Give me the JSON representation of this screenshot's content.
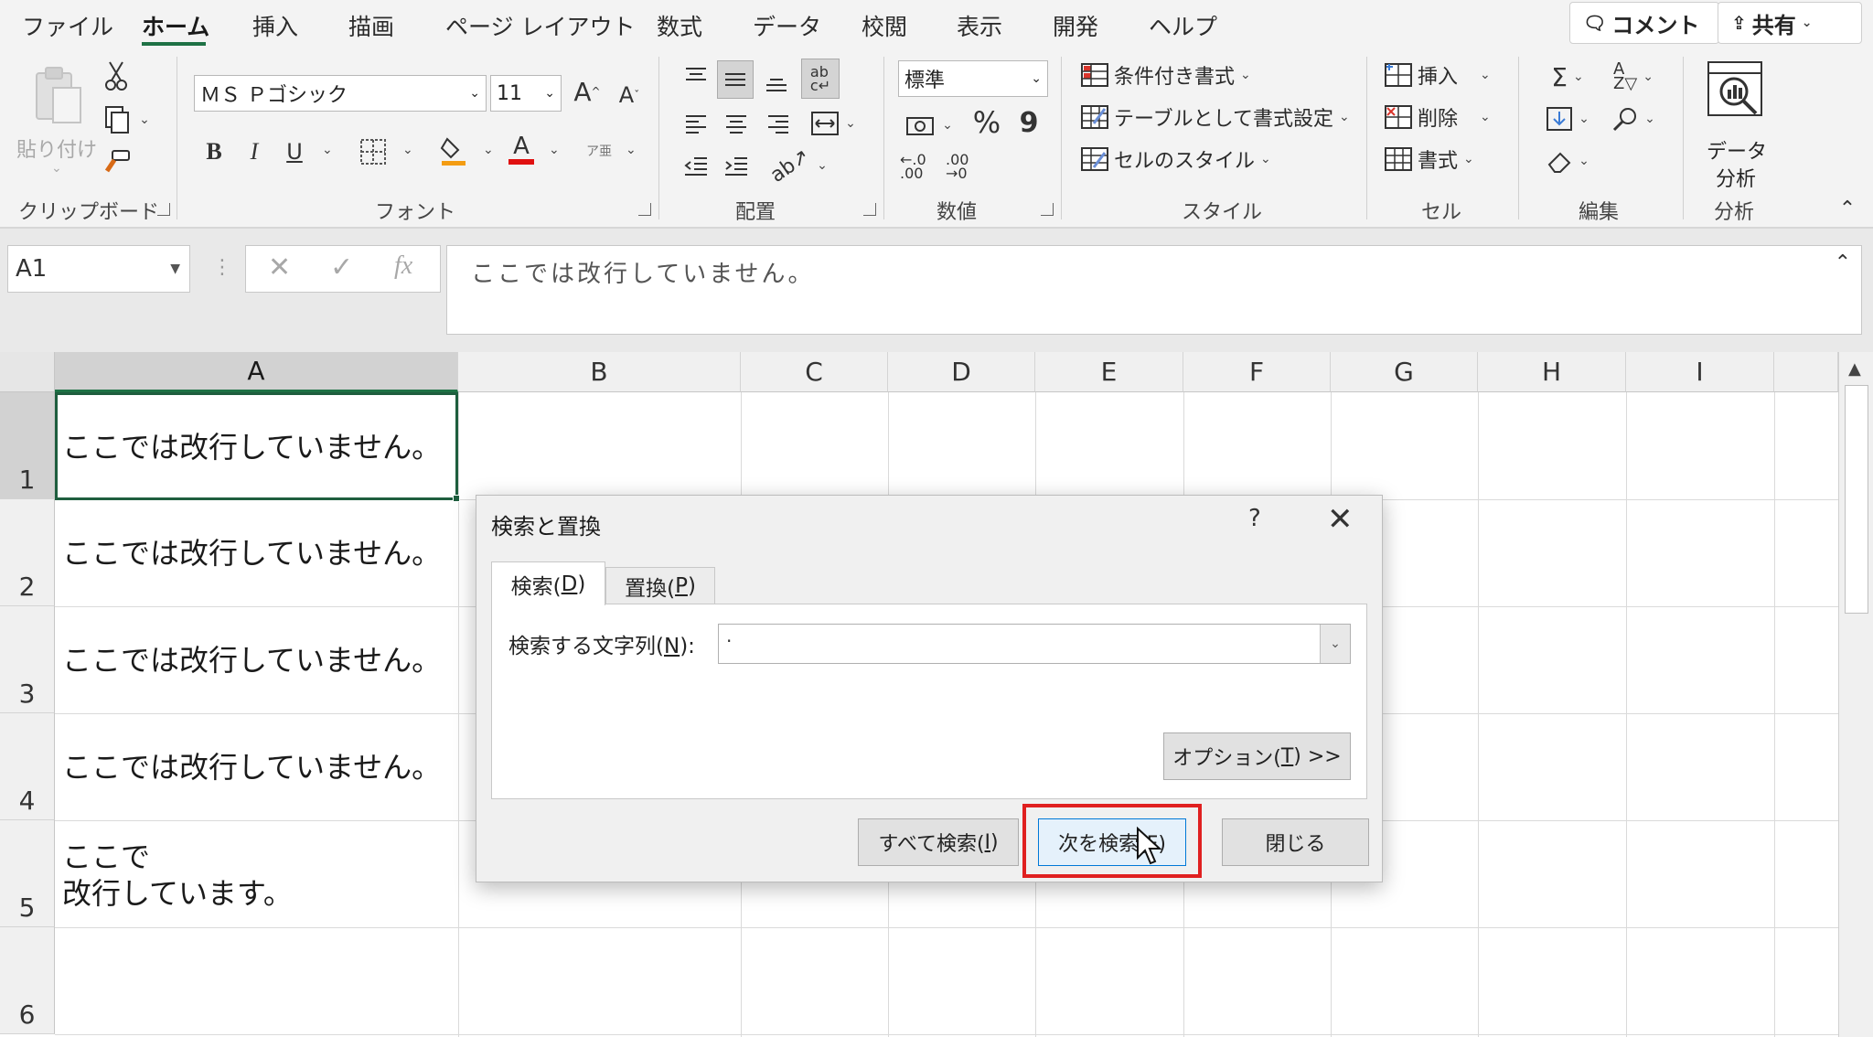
{
  "tabs": [
    "ファイル",
    "ホーム",
    "挿入",
    "描画",
    "ページ レイアウト",
    "数式",
    "データ",
    "校閲",
    "表示",
    "開発",
    "ヘルプ"
  ],
  "active_tab": "ホーム",
  "top_buttons": {
    "comment": "コメント",
    "share": "共有"
  },
  "ribbon": {
    "clipboard": {
      "paste": "貼り付け",
      "label": "クリップボード"
    },
    "font": {
      "name": "ＭＳ Ｐゴシック",
      "size": "11",
      "bold": "B",
      "italic": "I",
      "underline": "U",
      "label": "フォント",
      "grow": "A",
      "shrink": "A",
      "phonetic": "ア亜",
      "font_color": "A"
    },
    "alignment": {
      "label": "配置"
    },
    "number": {
      "format": "標準",
      "percent": "%",
      "comma": "9",
      "inc_decimal": "←.0 .00",
      "dec_decimal": ".00 →0",
      "label": "数値"
    },
    "styles": {
      "conditional": "条件付き書式",
      "as_table": "テーブルとして書式設定",
      "cell_styles": "セルのスタイル",
      "label": "スタイル"
    },
    "cells": {
      "insert": "挿入",
      "delete": "削除",
      "format": "書式",
      "label": "セル"
    },
    "editing": {
      "label": "編集"
    },
    "analysis": {
      "button": "データ\n分析",
      "button_line1": "データ",
      "button_line2": "分析",
      "label": "分析"
    }
  },
  "formula_bar": {
    "name_box": "A1",
    "content": "ここでは改行していません。"
  },
  "columns": [
    "A",
    "B",
    "C",
    "D",
    "E",
    "F",
    "G",
    "H",
    "I"
  ],
  "rows": [
    "1",
    "2",
    "3",
    "4",
    "5",
    "6"
  ],
  "cells": [
    "ここでは改行していません。",
    "ここでは改行していません。",
    "ここでは改行していません。",
    "ここでは改行していません。",
    "ここで",
    "改行しています。"
  ],
  "dialog": {
    "title": "検索と置換",
    "help": "?",
    "close": "✕",
    "tab_find": "検索(D)",
    "tab_find_pre": "検索(",
    "tab_find_key": "D",
    "tab_find_post": ")",
    "tab_replace_pre": "置換(",
    "tab_replace_key": "P",
    "tab_replace_post": ")",
    "find_label_pre": "検索する文字列(",
    "find_label_key": "N",
    "find_label_post": "):",
    "find_value": ".",
    "options_pre": "オプション(",
    "options_key": "T",
    "options_post": ") >>",
    "find_all_pre": "すべて検索(",
    "find_all_key": "I",
    "find_all_post": ")",
    "find_next": "次を検索(F)",
    "close_button": "閉じる"
  }
}
